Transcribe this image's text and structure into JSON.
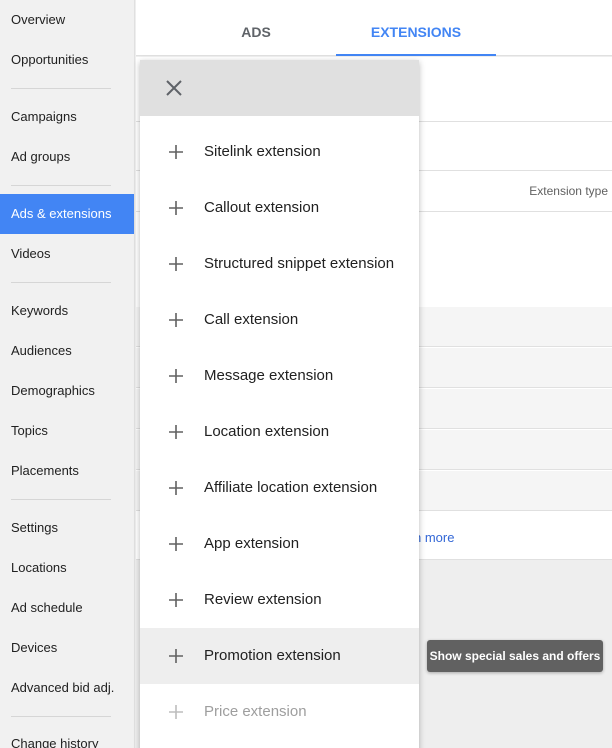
{
  "sidebar": {
    "items": [
      {
        "label": "Overview"
      },
      {
        "label": "Opportunities"
      },
      {
        "label": "Campaigns"
      },
      {
        "label": "Ad groups"
      },
      {
        "label": "Ads & extensions"
      },
      {
        "label": "Videos"
      },
      {
        "label": "Keywords"
      },
      {
        "label": "Audiences"
      },
      {
        "label": "Demographics"
      },
      {
        "label": "Topics"
      },
      {
        "label": "Placements"
      },
      {
        "label": "Settings"
      },
      {
        "label": "Locations"
      },
      {
        "label": "Ad schedule"
      },
      {
        "label": "Devices"
      },
      {
        "label": "Advanced bid adj."
      },
      {
        "label": "Change history"
      }
    ],
    "active_item": "Ads & extensions",
    "active_color": "#4285f4"
  },
  "tabs": [
    {
      "label": "ADS",
      "selected": false
    },
    {
      "label": "EXTENSIONS",
      "selected": true
    }
  ],
  "table": {
    "column_header": "Extension type",
    "learn_more_fragment": "n more"
  },
  "menu": {
    "close_icon": "close-icon",
    "items": [
      {
        "label": "Sitelink extension",
        "icon": "plus-icon",
        "enabled": true
      },
      {
        "label": "Callout extension",
        "icon": "plus-icon",
        "enabled": true
      },
      {
        "label": "Structured snippet extension",
        "icon": "plus-icon",
        "enabled": true
      },
      {
        "label": "Call extension",
        "icon": "plus-icon",
        "enabled": true
      },
      {
        "label": "Message extension",
        "icon": "plus-icon",
        "enabled": true
      },
      {
        "label": "Location extension",
        "icon": "plus-icon",
        "enabled": true
      },
      {
        "label": "Affiliate location extension",
        "icon": "plus-icon",
        "enabled": true
      },
      {
        "label": "App extension",
        "icon": "plus-icon",
        "enabled": true
      },
      {
        "label": "Review extension",
        "icon": "plus-icon",
        "enabled": true
      },
      {
        "label": "Promotion extension",
        "icon": "plus-icon",
        "enabled": true,
        "hovered": true
      },
      {
        "label": "Price extension",
        "icon": "plus-icon",
        "enabled": false
      }
    ]
  },
  "tooltip": {
    "text": "Show special sales and offers"
  }
}
